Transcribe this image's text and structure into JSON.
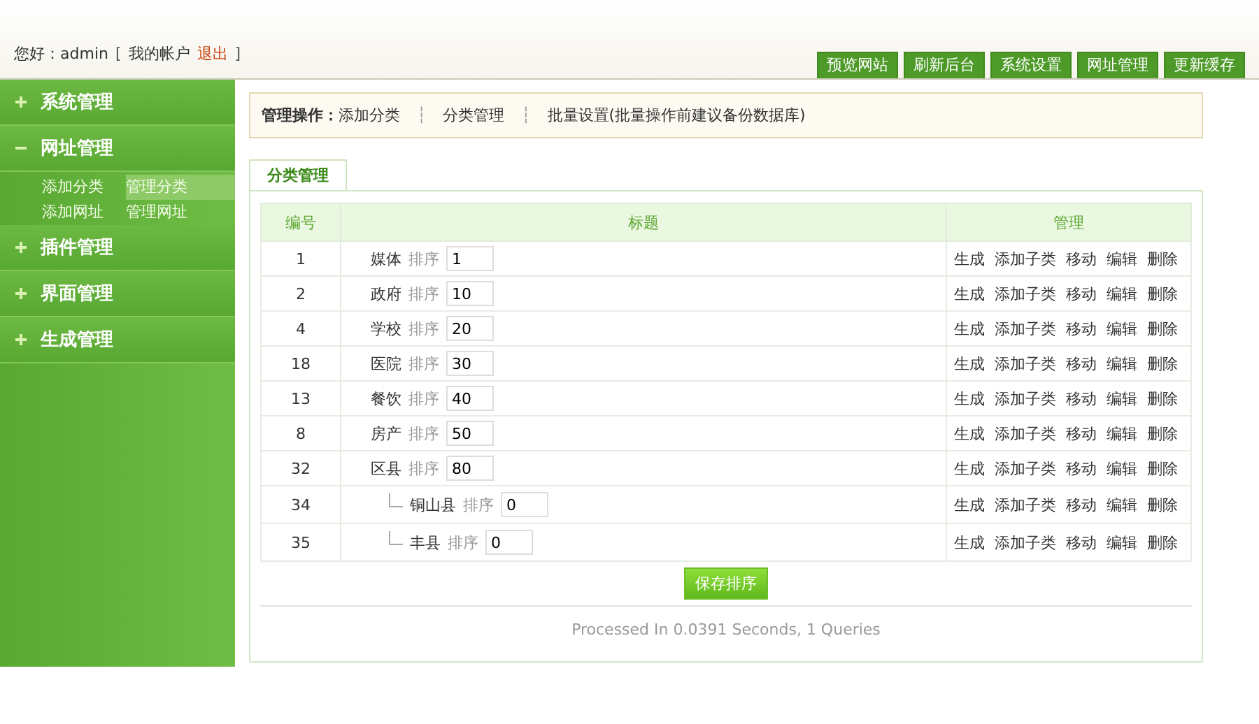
{
  "header": {
    "greeting": "您好：admin",
    "account_open": "[",
    "account_link": "我的帐户",
    "logout": "退出",
    "account_close": "]"
  },
  "top_nav": [
    {
      "label": "预览网站"
    },
    {
      "label": "刷新后台"
    },
    {
      "label": "系统设置"
    },
    {
      "label": "网址管理"
    },
    {
      "label": "更新缓存"
    }
  ],
  "sidebar": {
    "items": [
      {
        "label": "系统管理",
        "expanded": false
      },
      {
        "label": "网址管理",
        "expanded": true,
        "children": [
          {
            "label": "添加分类",
            "selected": false
          },
          {
            "label": "管理分类",
            "selected": true
          },
          {
            "label": "添加网址",
            "selected": false
          },
          {
            "label": "管理网址",
            "selected": false
          }
        ]
      },
      {
        "label": "插件管理",
        "expanded": false
      },
      {
        "label": "界面管理",
        "expanded": false
      },
      {
        "label": "生成管理",
        "expanded": false
      }
    ]
  },
  "toolbar": {
    "label": "管理操作：",
    "links": [
      "添加分类",
      "分类管理",
      "批量设置(批量操作前建议备份数据库)"
    ],
    "separator": "┆"
  },
  "tab": {
    "label": "分类管理",
    "selected": true
  },
  "table": {
    "columns": [
      "编号",
      "标题",
      "管理"
    ],
    "rows": [
      {
        "id": "1",
        "name": "媒体",
        "sort_label": "排序",
        "sort": "1",
        "actions": [
          "生成",
          "添加子类",
          "移动",
          "编辑",
          "删除"
        ]
      },
      {
        "id": "2",
        "name": "政府",
        "sort_label": "排序",
        "sort": "10",
        "actions": [
          "生成",
          "添加子类",
          "移动",
          "编辑",
          "删除"
        ]
      },
      {
        "id": "4",
        "name": "学校",
        "sort_label": "排序",
        "sort": "20",
        "actions": [
          "生成",
          "添加子类",
          "移动",
          "编辑",
          "删除"
        ]
      },
      {
        "id": "18",
        "name": "医院",
        "sort_label": "排序",
        "sort": "30",
        "actions": [
          "生成",
          "添加子类",
          "移动",
          "编辑",
          "删除"
        ]
      },
      {
        "id": "13",
        "name": "餐饮",
        "sort_label": "排序",
        "sort": "40",
        "actions": [
          "生成",
          "添加子类",
          "移动",
          "编辑",
          "删除"
        ]
      },
      {
        "id": "8",
        "name": "房产",
        "sort_label": "排序",
        "sort": "50",
        "actions": [
          "生成",
          "添加子类",
          "移动",
          "编辑",
          "删除"
        ]
      },
      {
        "id": "32",
        "name": "区县",
        "sort_label": "排序",
        "sort": "80",
        "actions": [
          "生成",
          "添加子类",
          "移动",
          "编辑",
          "删除"
        ],
        "children": [
          {
            "id": "34",
            "name": "铜山县",
            "sort_label": "排序",
            "sort": "0",
            "actions": [
              "生成",
              "添加子类",
              "移动",
              "编辑",
              "删除"
            ]
          },
          {
            "id": "35",
            "name": "丰县",
            "sort_label": "排序",
            "sort": "0",
            "actions": [
              "生成",
              "添加子类",
              "移动",
              "编辑",
              "删除"
            ]
          }
        ]
      }
    ]
  },
  "save_button": "保存排序",
  "footer": "Processed In 0.0391 Seconds, 1 Queries"
}
